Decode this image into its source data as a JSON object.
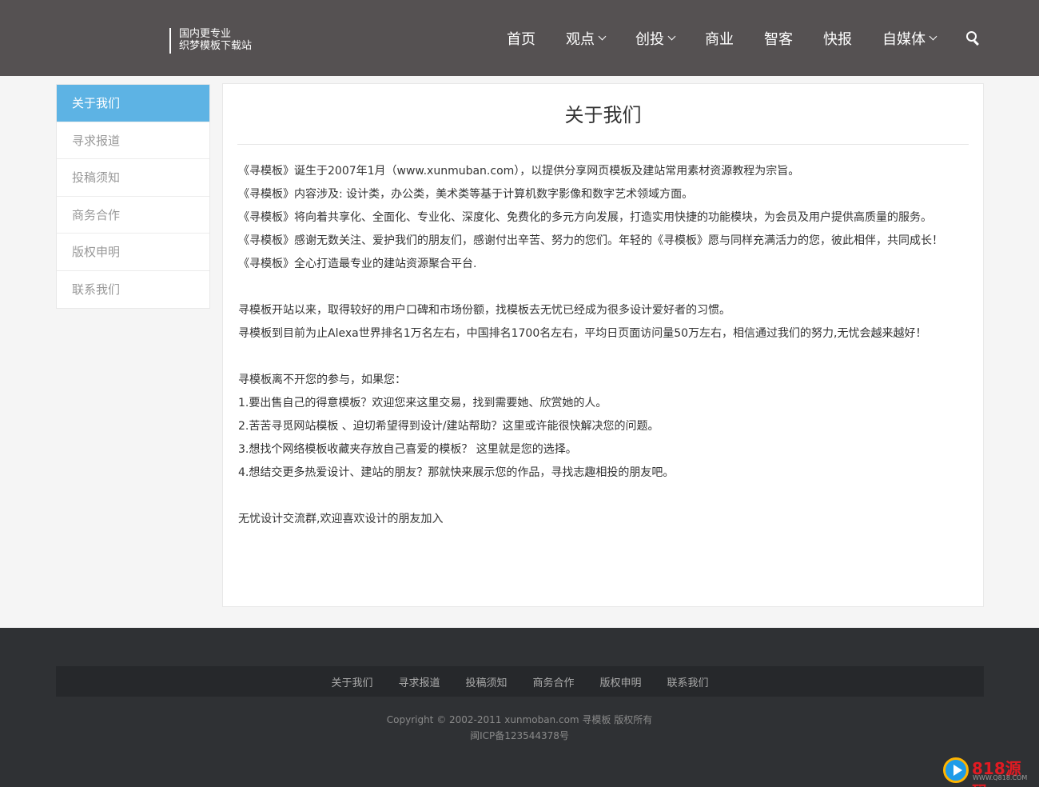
{
  "header": {
    "slogan_line1": "国内更专业",
    "slogan_line2": "织梦模板下载站",
    "nav": [
      {
        "label": "首页",
        "dropdown": false
      },
      {
        "label": "观点",
        "dropdown": true
      },
      {
        "label": "创投",
        "dropdown": true
      },
      {
        "label": "商业",
        "dropdown": false
      },
      {
        "label": "智客",
        "dropdown": false
      },
      {
        "label": "快报",
        "dropdown": false
      },
      {
        "label": "自媒体",
        "dropdown": true
      }
    ],
    "search_icon": "search-icon"
  },
  "sidebar": {
    "items": [
      {
        "label": "关于我们",
        "active": true
      },
      {
        "label": "寻求报道",
        "active": false
      },
      {
        "label": "投稿须知",
        "active": false
      },
      {
        "label": "商务合作",
        "active": false
      },
      {
        "label": "版权申明",
        "active": false
      },
      {
        "label": "联系我们",
        "active": false
      }
    ]
  },
  "content": {
    "title": "关于我们",
    "paragraphs": [
      "《寻模板》诞生于2007年1月（www.xunmuban.com），以提供分享网页模板及建站常用素材资源教程为宗旨。",
      "《寻模板》内容涉及: 设计类，办公类，美术类等基于计算机数字影像和数字艺术领域方面。",
      "《寻模板》将向着共享化、全面化、专业化、深度化、免费化的多元方向发展，打造实用快捷的功能模块，为会员及用户提供高质量的服务。",
      "《寻模板》感谢无数关注、爱护我们的朋友们，感谢付出辛苦、努力的您们。年轻的《寻模板》愿与同样充满活力的您，彼此相伴，共同成长！",
      "《寻模板》全心打造最专业的建站资源聚合平台.",
      "",
      "寻模板开站以来，取得较好的用户口碑和市场份额，找模板去无忧已经成为很多设计爱好者的习惯。",
      "寻模板到目前为止Alexa世界排名1万名左右，中国排名1700名左右，平均日页面访问量50万左右，相信通过我们的努力,无忧会越来越好！",
      "",
      "寻模板离不开您的参与，如果您：",
      "1.要出售自己的得意模板？欢迎您来这里交易，找到需要她、欣赏她的人。",
      "2.苦苦寻觅网站模板 、迫切希望得到设计/建站帮助？这里或许能很快解决您的问题。",
      "3.想找个网络模板收藏夹存放自己喜爱的模板？ 这里就是您的选择。",
      "4.想结交更多热爱设计、建站的朋友？那就快来展示您的作品，寻找志趣相投的朋友吧。",
      "",
      "无忧设计交流群,欢迎喜欢设计的朋友加入"
    ]
  },
  "footer": {
    "links": [
      "关于我们",
      "寻求报道",
      "投稿须知",
      "商务合作",
      "版权申明",
      "联系我们"
    ],
    "copyright": "Copyright © 2002-2011 xunmoban.com 寻模板 版权所有",
    "icp": "闽ICP备123544378号"
  },
  "watermark": {
    "text": "818源码",
    "sub": "WWW.Q818.COM"
  },
  "colors": {
    "header_bg": "#555152",
    "accent": "#5db3e4",
    "footer_bg": "#2f3134"
  }
}
